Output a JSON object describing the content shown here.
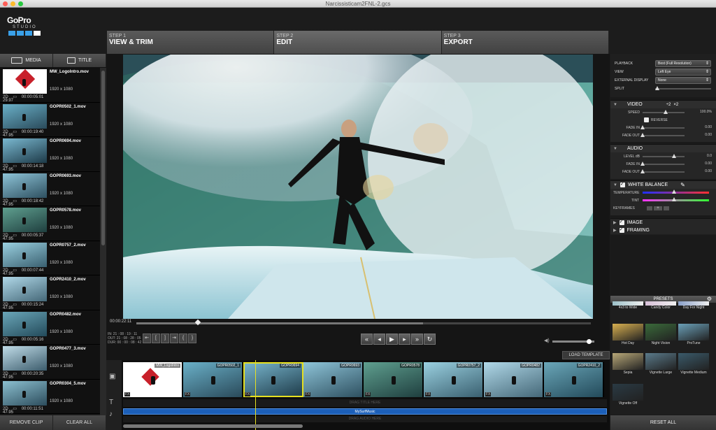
{
  "window": {
    "title": "Narcissisticam2FNL-2.gcs"
  },
  "logo": {
    "line1": "GoPro",
    "line2": "STUDIO"
  },
  "steps": [
    {
      "num": "STEP 1",
      "title": "VIEW & TRIM"
    },
    {
      "num": "STEP 2",
      "title": "EDIT"
    },
    {
      "num": "STEP 3",
      "title": "EXPORT"
    }
  ],
  "media_tabs": {
    "media": "MEDIA",
    "title": "TITLE"
  },
  "clips": [
    {
      "name": "MW_LogoIntro.mov",
      "res": "1920 x 1080",
      "badge": "2D",
      "duration": "00:00:05:01",
      "fps": "29.97"
    },
    {
      "name": "GOPR0502_1.mov",
      "res": "1920 x 1080",
      "badge": "2D",
      "duration": "00:00:19:40",
      "fps": "47.95"
    },
    {
      "name": "GOPR0694.mov",
      "res": "1920 x 1080",
      "badge": "2D",
      "duration": "00:00:14:18",
      "fps": "47.95"
    },
    {
      "name": "GOPR0693.mov",
      "res": "1920 x 1080",
      "badge": "2D",
      "duration": "00:00:18:42",
      "fps": "47.95"
    },
    {
      "name": "GOPR0578.mov",
      "res": "1920 x 1080",
      "badge": "2D",
      "duration": "00:00:05:37",
      "fps": "47.95"
    },
    {
      "name": "GOPR0757_2.mov",
      "res": "1920 x 1080",
      "badge": "2D",
      "duration": "00:00:07:44",
      "fps": "47.95"
    },
    {
      "name": "GOPR2410_2.mov",
      "res": "1920 x 1080",
      "badge": "2D",
      "duration": "00:00:15:24",
      "fps": "47.95"
    },
    {
      "name": "GOPR0482.mov",
      "res": "1920 x 1080",
      "badge": "2D",
      "duration": "00:00:05:16",
      "fps": "47.95"
    },
    {
      "name": "GOPR0477_3.mov",
      "res": "1920 x 1080",
      "badge": "2D",
      "duration": "00:00:20:35",
      "fps": "47.95"
    },
    {
      "name": "GOPR0304_5.mov",
      "res": "1920 x 1080",
      "badge": "2D",
      "duration": "00:00:11:51",
      "fps": "47.95"
    }
  ],
  "left_buttons": {
    "remove": "REMOVE CLIP",
    "clear": "CLEAR ALL"
  },
  "player": {
    "timecode": "00:00:22:11",
    "tc_in": "IN: 21 : 08 : 19 : 11",
    "tc_out": "OUT: 21 : 08 : 28 : 05",
    "tc_dur": "DUR: 00 : 00 : 08 : 42",
    "progress": 0.13
  },
  "load_template": "LOAD TEMPLATE",
  "timeline": {
    "clips": [
      {
        "label": "MW_LogoIntro",
        "fx": "FX"
      },
      {
        "label": "GOPR0502_1",
        "fx": "FX"
      },
      {
        "label": "GOPR0694",
        "fx": "FX"
      },
      {
        "label": "GOPR0693",
        "fx": "FX"
      },
      {
        "label": "GOPR0578",
        "fx": "FX"
      },
      {
        "label": "GOPR0757_2",
        "fx": "FX"
      },
      {
        "label": "GOPR0482",
        "fx": "FX"
      },
      {
        "label": "GOPR2410_2",
        "fx": "FX"
      }
    ],
    "title_track": "DRAG TITLE HERE",
    "audio_clip": "MySurfMusic",
    "audio_track2": "DRAG AUDIO HERE"
  },
  "playback": {
    "playback_label": "PLAYBACK",
    "playback_value": "Best (Full Resolution)",
    "view_label": "VIEW",
    "view_value": "Left Eye",
    "ext_label": "EXTERNAL DISPLAY",
    "ext_value": "None",
    "split_label": "SPLIT"
  },
  "video_sect": {
    "title": "VIDEO",
    "x2a": "÷2",
    "x2b": "×2",
    "speed_label": "SPEED",
    "speed_value": "100.0%",
    "reverse_label": "REVERSE",
    "fadein_label": "FADE IN",
    "fadein_value": "0.00",
    "fadeout_label": "FADE OUT",
    "fadeout_value": "0.00"
  },
  "audio_sect": {
    "title": "AUDIO",
    "level_label": "LEVEL dB",
    "level_value": "0.0",
    "fadein_label": "FADE IN",
    "fadein_value": "0.00",
    "fadeout_label": "FADE OUT",
    "fadeout_value": "0.00"
  },
  "wb_sect": {
    "title": "WHITE BALANCE",
    "temp_label": "TEMPERATURE",
    "tint_label": "TINT",
    "kf_label": "KEYFRAMES"
  },
  "image_sect": {
    "title": "IMAGE"
  },
  "framing_sect": {
    "title": "FRAMING"
  },
  "presets": {
    "title": "PRESETS",
    "items": [
      "4x3 to Wide",
      "Candy Color",
      "Day For Night",
      "Hot Day",
      "Night Vision",
      "ProTune",
      "Sepia",
      "Vignette Large",
      "Vignette Medium",
      "Vignette Off"
    ]
  },
  "reset_all": "RESET ALL"
}
